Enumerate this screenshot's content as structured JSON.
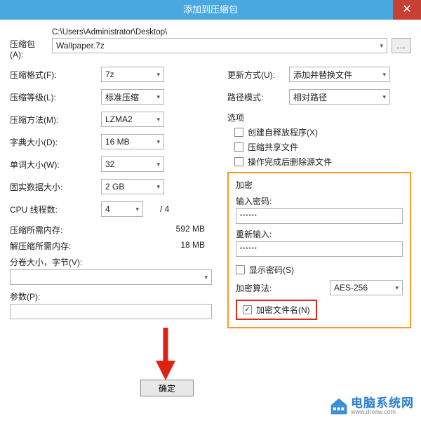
{
  "title": "添加到压缩包",
  "archive": {
    "label": "压缩包(A):",
    "path": "C:\\Users\\Administrator\\Desktop\\",
    "filename": "Wallpaper.7z",
    "browse": "..."
  },
  "format": {
    "label": "压缩格式(F):",
    "value": "7z"
  },
  "level": {
    "label": "压缩等级(L):",
    "value": "标准压缩"
  },
  "method": {
    "label": "压缩方法(M):",
    "value": "LZMA2"
  },
  "dict": {
    "label": "字典大小(D):",
    "value": "16 MB"
  },
  "word": {
    "label": "单词大小(W):",
    "value": "32"
  },
  "solid": {
    "label": "固实数据大小:",
    "value": "2 GB"
  },
  "cpu": {
    "label": "CPU 线程数:",
    "value": "4",
    "total": "/ 4"
  },
  "mem1": {
    "label": "压缩所需内存:",
    "value": "592 MB"
  },
  "mem2": {
    "label": "解压缩所需内存:",
    "value": "18 MB"
  },
  "split": {
    "label": "分卷大小，字节(V):"
  },
  "params": {
    "label": "参数(P):"
  },
  "update": {
    "label": "更新方式(U):",
    "value": "添加并替换文件"
  },
  "pathmode": {
    "label": "路径模式:",
    "value": "相对路径"
  },
  "options": {
    "title": "选项",
    "sfx": "创建自释放程序(X)",
    "share": "压缩共享文件",
    "delete": "操作完成后删除源文件"
  },
  "enc": {
    "title": "加密",
    "pwd_label": "输入密码:",
    "pwd_value": "******",
    "rpwd_label": "重新输入:",
    "rpwd_value": "******",
    "show": "显示密码(S)",
    "alg_label": "加密算法:",
    "alg_value": "AES-256",
    "encname": "加密文件名(N)"
  },
  "ok": "确定",
  "watermark": {
    "cn": "电脑系统网",
    "url": "www.dnxtw.com"
  }
}
